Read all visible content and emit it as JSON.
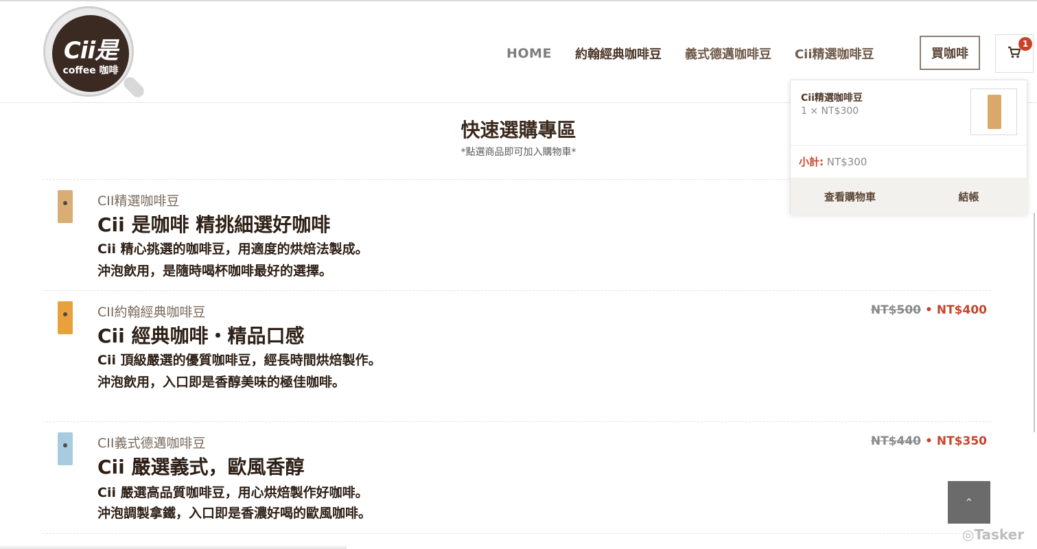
{
  "header": {
    "logo_text": "Cii是",
    "logo_sub": "coffee 咖啡",
    "nav": [
      "HOME",
      "約翰經典咖啡豆",
      "義式德邁咖啡豆",
      "Cii精選咖啡豆"
    ],
    "buy_button": "買咖啡",
    "cart_count": "1"
  },
  "section": {
    "title": "快速選購專區",
    "subtitle": "*點選商品即可加入購物車*"
  },
  "products": [
    {
      "category": "CII精選咖啡豆",
      "name": "Cii 是咖啡 精挑細選好咖啡",
      "desc1": "Cii 精心挑選的咖啡豆，用適度的烘焙法製成。",
      "desc2": "沖泡飲用，是隨時喝杯咖啡最好的選擇。",
      "bag_color": "#d9ad74"
    },
    {
      "category": "CII約翰經典咖啡豆",
      "name": "Cii 經典咖啡・精品口感",
      "desc1": "Cii 頂級嚴選的優質咖啡豆，經長時間烘焙製作。",
      "desc2": "沖泡飲用，入口即是香醇美味的極佳咖啡。",
      "old_price": "NT$500",
      "dot": "•",
      "new_price": "NT$400",
      "bag_color": "#e9a23b"
    },
    {
      "category": "CII義式德邁咖啡豆",
      "name": "Cii 嚴選義式，歐風香醇",
      "desc1": "Cii 嚴選高品質咖啡豆，用心烘焙製作好咖啡。",
      "desc2": "沖泡調製拿鐵，入口即是香濃好喝的歐風咖啡。",
      "old_price": "NT$440",
      "dot": "•",
      "new_price": "NT$350",
      "bag_color": "#a9cbe0"
    }
  ],
  "mini_cart": {
    "item_name": "Cii精選咖啡豆",
    "item_qty": "1 × NT$300",
    "subtotal_label": "小計:",
    "subtotal_value": "NT$300",
    "view_cart": "查看購物車",
    "checkout": "結帳"
  },
  "back_to_top": "⌃",
  "watermark": "Tasker"
}
